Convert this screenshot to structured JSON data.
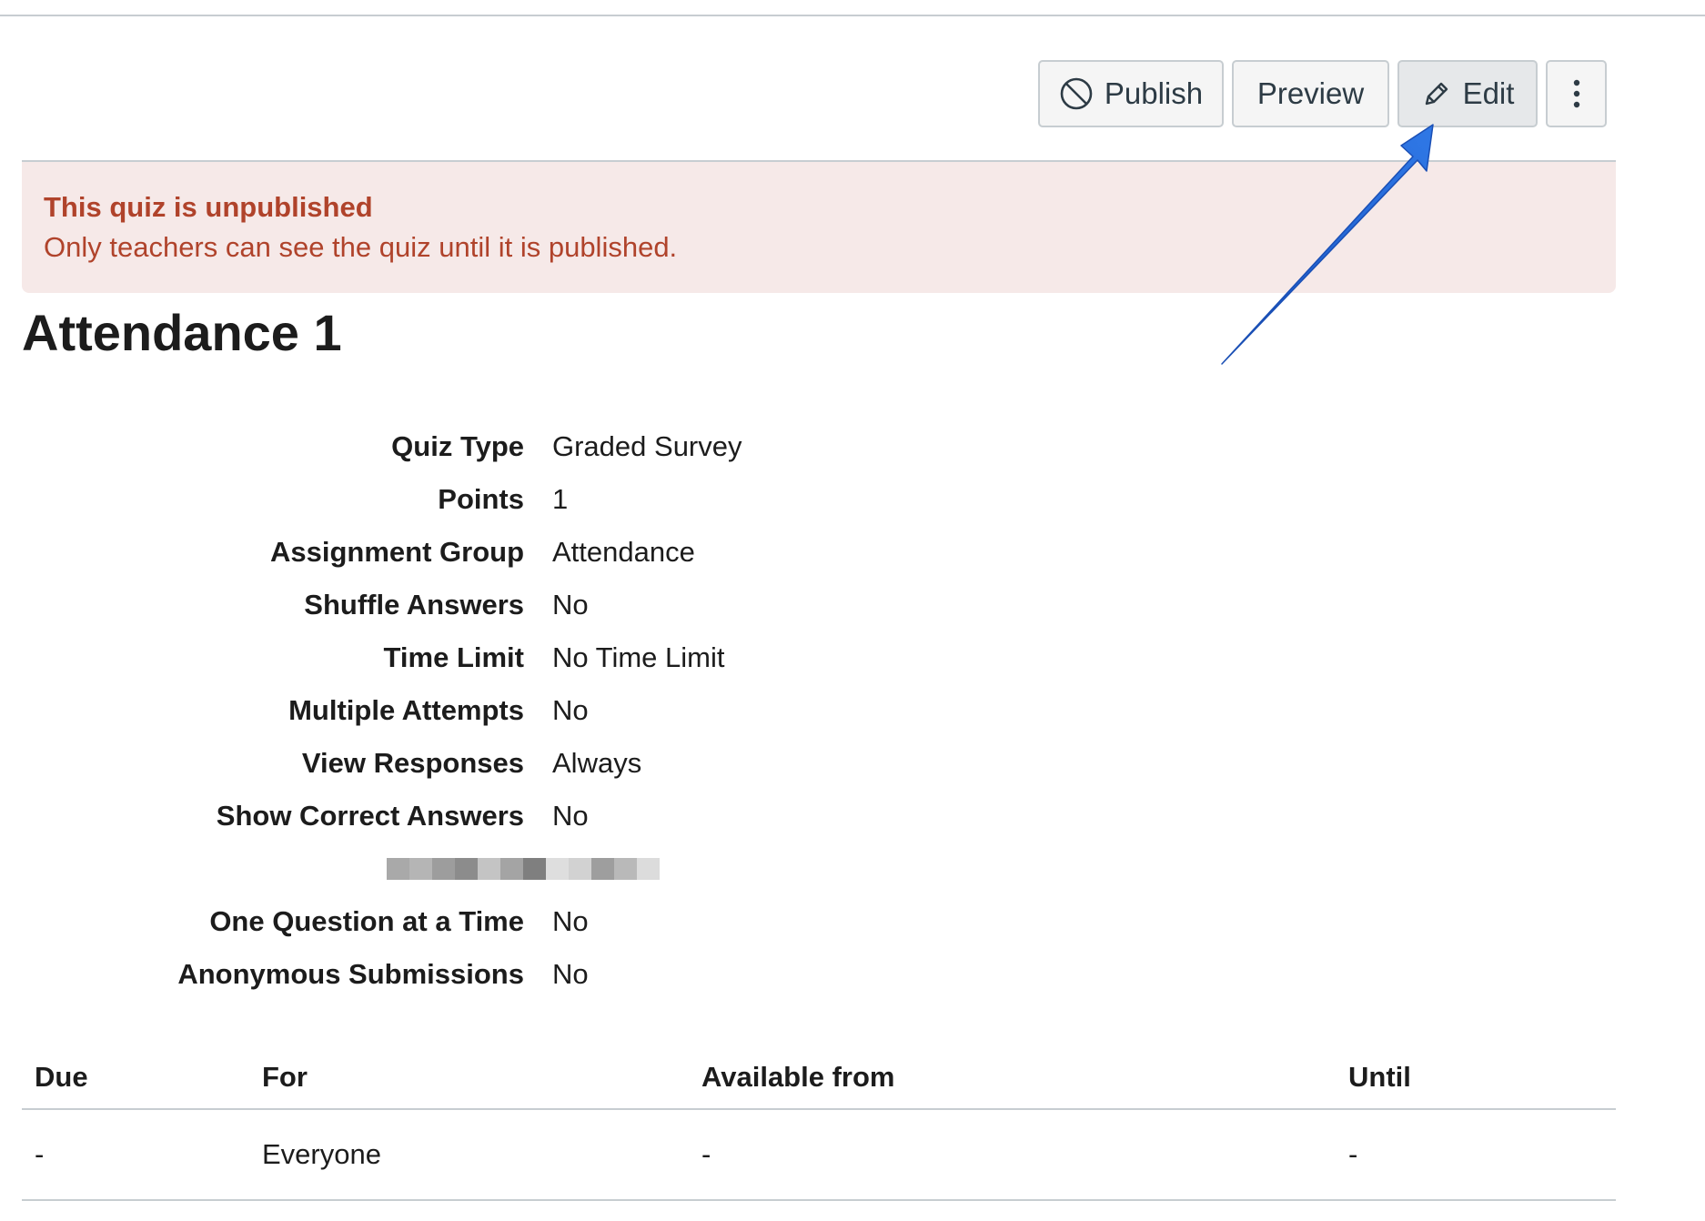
{
  "toolbar": {
    "publish_label": "Publish",
    "preview_label": "Preview",
    "edit_label": "Edit",
    "publish_icon": "unpublished-circle-slash-icon",
    "edit_icon": "pencil-icon",
    "more_icon": "vertical-ellipsis-icon"
  },
  "banner": {
    "title": "This quiz is unpublished",
    "text": "Only teachers can see the quiz until it is published."
  },
  "quiz": {
    "title": "Attendance 1"
  },
  "details": [
    {
      "label": "Quiz Type",
      "value": "Graded Survey"
    },
    {
      "label": "Points",
      "value": "1"
    },
    {
      "label": "Assignment Group",
      "value": "Attendance"
    },
    {
      "label": "Shuffle Answers",
      "value": "No"
    },
    {
      "label": "Time Limit",
      "value": "No Time Limit"
    },
    {
      "label": "Multiple Attempts",
      "value": "No"
    },
    {
      "label": "View Responses",
      "value": "Always"
    },
    {
      "label": "Show Correct Answers",
      "value": "No"
    },
    {
      "label": "One Question at a Time",
      "value": "No"
    },
    {
      "label": "Anonymous Submissions",
      "value": "No"
    }
  ],
  "dates": {
    "headers": {
      "due": "Due",
      "for": "For",
      "from": "Available from",
      "until": "Until"
    },
    "rows": [
      {
        "due": "-",
        "for": "Everyone",
        "from": "-",
        "until": "-"
      }
    ]
  },
  "colors": {
    "banner_text": "#b0432b",
    "banner_bg": "#f6e9e8",
    "annotation_arrow": "#1e5fc9"
  }
}
